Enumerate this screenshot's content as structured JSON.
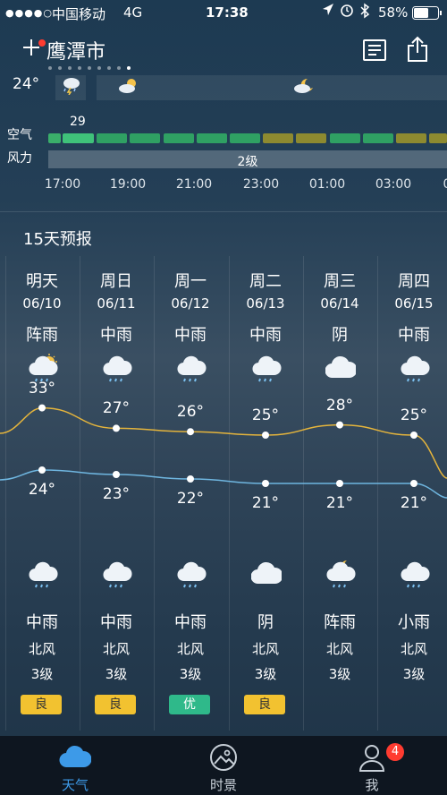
{
  "status_bar": {
    "signal": "●●●●○",
    "carrier": "中国移动",
    "network": "4G",
    "time": "17:38",
    "battery": "58%"
  },
  "header": {
    "city": "鹰潭市"
  },
  "hourly": {
    "temp": "24°",
    "aqi_label": "空气",
    "aqi_value": "29",
    "wind_label": "风力",
    "wind_value": "2级",
    "hours": [
      "17:00",
      "19:00",
      "21:00",
      "23:00",
      "01:00",
      "03:00",
      "0"
    ]
  },
  "forecast": {
    "title": "15天预报",
    "days": [
      {
        "day": "明天",
        "date": "06/10",
        "cond": "阵雨",
        "high": "33°",
        "low": "24°",
        "night_cond": "中雨",
        "wind_dir": "北风",
        "wind_level": "3级",
        "aqi": "良",
        "aqi_color": "#f2c230",
        "day_icon": "sun-rain-icon",
        "night_icon": "rain-cloud-icon"
      },
      {
        "day": "周日",
        "date": "06/11",
        "cond": "中雨",
        "high": "27°",
        "low": "23°",
        "night_cond": "中雨",
        "wind_dir": "北风",
        "wind_level": "3级",
        "aqi": "良",
        "aqi_color": "#f2c230",
        "day_icon": "rain-cloud-icon",
        "night_icon": "rain-cloud-icon"
      },
      {
        "day": "周一",
        "date": "06/12",
        "cond": "中雨",
        "high": "26°",
        "low": "22°",
        "night_cond": "中雨",
        "wind_dir": "北风",
        "wind_level": "3级",
        "aqi": "优",
        "aqi_color": "#2fb98a",
        "day_icon": "rain-cloud-icon",
        "night_icon": "rain-cloud-icon"
      },
      {
        "day": "周二",
        "date": "06/13",
        "cond": "中雨",
        "high": "25°",
        "low": "21°",
        "night_cond": "阴",
        "wind_dir": "北风",
        "wind_level": "3级",
        "aqi": "良",
        "aqi_color": "#f2c230",
        "day_icon": "rain-cloud-icon",
        "night_icon": "cloud-icon"
      },
      {
        "day": "周三",
        "date": "06/14",
        "cond": "阴",
        "high": "28°",
        "low": "21°",
        "night_cond": "阵雨",
        "wind_dir": "北风",
        "wind_level": "3级",
        "aqi": "",
        "aqi_color": "",
        "day_icon": "cloud-icon",
        "night_icon": "moon-rain-icon"
      },
      {
        "day": "周四",
        "date": "06/15",
        "cond": "中雨",
        "high": "25°",
        "low": "21°",
        "night_cond": "小雨",
        "wind_dir": "北风",
        "wind_level": "3级",
        "aqi": "",
        "aqi_color": "",
        "day_icon": "rain-cloud-icon",
        "night_icon": "rain-cloud-icon"
      }
    ]
  },
  "tabs": [
    {
      "label": "天气",
      "icon": "cloud-icon",
      "active": true
    },
    {
      "label": "时景",
      "icon": "picture-icon",
      "active": false
    },
    {
      "label": "我",
      "icon": "person-icon",
      "active": false,
      "badge": "4"
    }
  ],
  "colors": {
    "active_tab": "#3d9ae8",
    "high_line": "#e4b43c",
    "low_line": "#6fb6e0"
  }
}
